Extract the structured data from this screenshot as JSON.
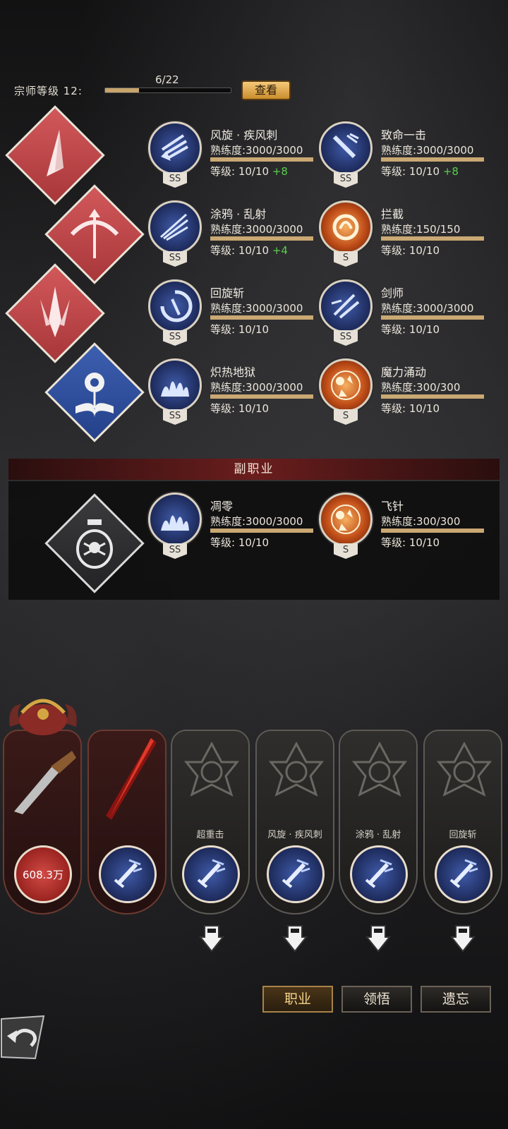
{
  "master_level": {
    "label": "宗师等级 12:",
    "count": "6/22",
    "progress": 0.27,
    "view_button": "查看"
  },
  "skills": [
    {
      "name": "风旋 · 疾风刺",
      "proficiency": "熟练度:3000/3000",
      "level": "等级: 10/10",
      "bonus": "+8",
      "rank": "SS",
      "tier": "blue"
    },
    {
      "name": "致命一击",
      "proficiency": "熟练度:3000/3000",
      "level": "等级: 10/10",
      "bonus": "+8",
      "rank": "SS",
      "tier": "blue"
    },
    {
      "name": "涂鸦 · 乱射",
      "proficiency": "熟练度:3000/3000",
      "level": "等级: 10/10",
      "bonus": "+4",
      "rank": "SS",
      "tier": "blue"
    },
    {
      "name": "拦截",
      "proficiency": "熟练度:150/150",
      "level": "等级: 10/10",
      "bonus": "",
      "rank": "S",
      "tier": "orange"
    },
    {
      "name": "回旋斩",
      "proficiency": "熟练度:3000/3000",
      "level": "等级: 10/10",
      "bonus": "",
      "rank": "SS",
      "tier": "blue"
    },
    {
      "name": "剑师",
      "proficiency": "熟练度:3000/3000",
      "level": "等级: 10/10",
      "bonus": "",
      "rank": "SS",
      "tier": "blue"
    },
    {
      "name": "炽热地狱",
      "proficiency": "熟练度:3000/3000",
      "level": "等级: 10/10",
      "bonus": "",
      "rank": "SS",
      "tier": "blue"
    },
    {
      "name": "魔力涌动",
      "proficiency": "熟练度:300/300",
      "level": "等级: 10/10",
      "bonus": "",
      "rank": "S",
      "tier": "orange"
    }
  ],
  "sub_job": {
    "title": "副职业",
    "skills": [
      {
        "name": "凋零",
        "proficiency": "熟练度:3000/3000",
        "level": "等级: 10/10",
        "rank": "SS",
        "tier": "blue"
      },
      {
        "name": "飞针",
        "proficiency": "熟练度:300/300",
        "level": "等级: 10/10",
        "rank": "S",
        "tier": "orange"
      }
    ]
  },
  "equip_slots": [
    {
      "label": "",
      "value": "608.3万",
      "icon": "pistol-icon"
    },
    {
      "label": "",
      "value": "",
      "icon": "sword-icon"
    },
    {
      "label": "超重击",
      "value": "",
      "icon": "fist-icon"
    },
    {
      "label": "风旋 · 疾风刺",
      "value": "",
      "icon": "blades-icon"
    },
    {
      "label": "涂鸦 · 乱射",
      "value": "",
      "icon": "burst-icon"
    },
    {
      "label": "回旋斩",
      "value": "",
      "icon": "spin-icon"
    }
  ],
  "tabs": {
    "profession": "职业",
    "comprehend": "领悟",
    "forget": "遗忘"
  },
  "colors": {
    "gold": "#c9a873",
    "bonus_green": "#58d04a",
    "red_class": "#c84a4c",
    "blue_class": "#2f4f9e"
  }
}
